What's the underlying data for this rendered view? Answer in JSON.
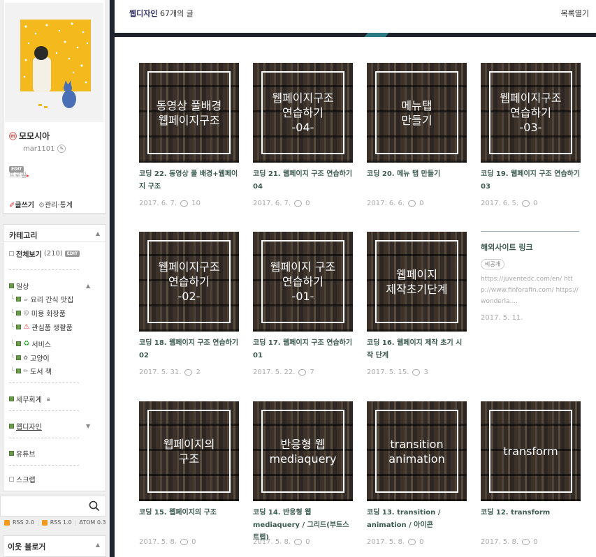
{
  "header": {
    "category": "웹디자인",
    "count": "67개의 글",
    "toggle": "목록열기"
  },
  "profile": {
    "name": "모모시아",
    "id": "mar1101",
    "edit": "EDIT",
    "link": "프로필",
    "write": "글쓰기",
    "manage": "관리·통계"
  },
  "categories": {
    "title": "카테고리",
    "all": {
      "label": "전체보기",
      "count": "(210)"
    },
    "items": [
      "일상",
      "요리 간식 맛집",
      "미용 화장품",
      "관심품 생활품",
      "서비스",
      "고양이",
      "도서 책",
      "세무회계",
      "웹디자인",
      "유튜브",
      "스크랩"
    ]
  },
  "rss": [
    "RSS 2.0",
    "RSS 1.0",
    "ATOM 0.3"
  ],
  "neighbor": {
    "title": "이웃 블로거"
  },
  "posts": [
    {
      "thumb": "동영상 풀배경\n웹페이지구조",
      "title": "코딩 22. 동영상 풀 배경+웹페이지 구조",
      "date": "2017. 6. 7.",
      "comments": "10"
    },
    {
      "thumb": "웹페이지구조\n연습하기\n-04-",
      "title": "코딩 21. 웹페이지 구조 연습하기 04",
      "date": "2017. 6. 7.",
      "comments": "0"
    },
    {
      "thumb": "메뉴탭\n만들기",
      "title": "코딩 20. 메뉴 탭 만들기",
      "date": "2017. 6. 6.",
      "comments": "0"
    },
    {
      "thumb": "웹페이지구조\n연습하기\n-03-",
      "title": "코딩 19. 웹페이지 구조 연습하기 03",
      "date": "2017. 6. 5.",
      "comments": "0"
    },
    {
      "thumb": "웹페이지구조\n연습하기\n-02-",
      "title": "코딩 18. 웹페이지 구조 연습하기 02",
      "date": "2017. 5. 31.",
      "comments": "2"
    },
    {
      "thumb": "웹페이지 구조\n연습하기\n-01-",
      "title": "코딩 17. 웹페이지 구조 연습하기 01",
      "date": "2017. 5. 22.",
      "comments": "7"
    },
    {
      "thumb": "웹페이지\n제작초기단계",
      "title": "코딩 16. 웹페이지 제작 초기 시작 단계",
      "date": "2017. 5. 15.",
      "comments": "3"
    },
    {
      "thumb": "웹페이지의\n구조",
      "title": "코딩 15. 웹페이지의 구조",
      "date": "2017. 5. 8.",
      "comments": "0"
    },
    {
      "thumb": "반응형 웹\nmediaquery",
      "title": "코딩 14. 반응형 웹 mediaquery / 그리드(부트스트랩)",
      "date": "2017. 5. 8.",
      "comments": "0"
    },
    {
      "thumb": "transition\nanimation",
      "title": "코딩 13. transition / animation / 아이콘",
      "date": "2017. 5. 8.",
      "comments": "0"
    },
    {
      "thumb": "transform",
      "title": "코딩 12. transform",
      "date": "2017. 5. 8.",
      "comments": "0"
    }
  ],
  "external": {
    "title": "해외사이트 링크",
    "tag": "비공개",
    "desc": "https://juventedc.com/en/ http://www.finforafin.com/ https://wonderla....",
    "date": "2017. 5. 11."
  }
}
